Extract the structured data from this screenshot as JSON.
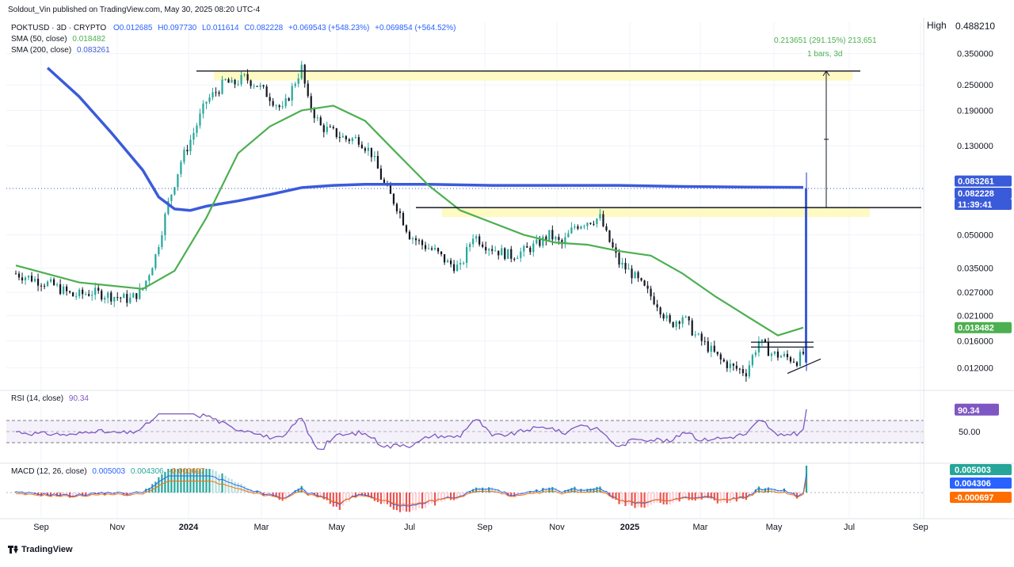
{
  "header": {
    "published": "Soldout_Vin published on TradingView.com, May 30, 2025 08:20 UTC-4"
  },
  "legend": {
    "symbol": "POKTUSD · 3D · CRYPTO",
    "open": "O0.012685",
    "high": "H0.097730",
    "low": "L0.011614",
    "close": "C0.082228",
    "change": "+0.069543 (+548.23%)",
    "change2": "+0.069854 (+564.52%)",
    "sma50_label": "SMA (50, close)",
    "sma50_value": "0.018482",
    "sma200_label": "SMA (200, close)",
    "sma200_value": "0.083261"
  },
  "measure": {
    "line1": "0.213651 (291.15%) 213,651",
    "line2": "1 bars, 3d"
  },
  "price_axis": {
    "high_label": "High",
    "high_value": "0.488210",
    "ticks": [
      "0.350000",
      "0.250000",
      "0.190000",
      "0.130000",
      "0.050000",
      "0.035000",
      "0.027000",
      "0.021000",
      "0.016000",
      "0.012000"
    ],
    "badge_sma200": "0.083261",
    "badge_price": "0.082228",
    "badge_time": "11:39:41",
    "badge_sma50": "0.018482"
  },
  "rsi": {
    "label": "RSI (14, close)",
    "value": "90.34",
    "badge": "90.34",
    "tick_50": "50.00"
  },
  "macd": {
    "label": "MACD (12, 26, close)",
    "v1": "0.005003",
    "v2": "0.004306",
    "v3": "-0.000697",
    "badge1": "0.005003",
    "badge2": "0.004306",
    "badge3": "-0.000697"
  },
  "time_axis": [
    "Sep",
    "Nov",
    "2024",
    "Mar",
    "May",
    "Jul",
    "Sep",
    "Nov",
    "2025",
    "Mar",
    "May",
    "Jul",
    "Sep"
  ],
  "footer": {
    "brand": "TradingView"
  },
  "colors": {
    "up": "#26a69a",
    "down": "#131722",
    "sma50": "#4caf50",
    "sma200": "#3a5bd9",
    "rsi": "#7e57c2",
    "macd_line": "#2962ff",
    "signal_line": "#ff6d00",
    "hist_up_strong": "#26a69a",
    "hist_up_weak": "#b2dfdb",
    "hist_down_strong": "#ef5350",
    "hist_down_weak": "#ffcdd2",
    "zone": "#fff9c4"
  },
  "chart_data": {
    "type": "candlestick",
    "symbol": "POKTUSD",
    "interval": "3D",
    "y_scale": "log",
    "ylim": [
      0.0095,
      0.49
    ],
    "x_labels": [
      "Sep",
      "Nov",
      "2024",
      "Mar",
      "May",
      "Jul",
      "Sep",
      "Nov",
      "2025",
      "Mar",
      "May",
      "Jul",
      "Sep"
    ],
    "close_path": [
      [
        0,
        0.033
      ],
      [
        6,
        0.031
      ],
      [
        12,
        0.029
      ],
      [
        18,
        0.026
      ],
      [
        24,
        0.027
      ],
      [
        30,
        0.026
      ],
      [
        36,
        0.025
      ],
      [
        40,
        0.028
      ],
      [
        44,
        0.04
      ],
      [
        48,
        0.07
      ],
      [
        52,
        0.11
      ],
      [
        56,
        0.15
      ],
      [
        60,
        0.21
      ],
      [
        64,
        0.24
      ],
      [
        66,
        0.26
      ],
      [
        68,
        0.25
      ],
      [
        72,
        0.27
      ],
      [
        76,
        0.25
      ],
      [
        80,
        0.22
      ],
      [
        84,
        0.19
      ],
      [
        88,
        0.26
      ],
      [
        90,
        0.3
      ],
      [
        92,
        0.21
      ],
      [
        96,
        0.16
      ],
      [
        100,
        0.15
      ],
      [
        104,
        0.14
      ],
      [
        108,
        0.14
      ],
      [
        112,
        0.12
      ],
      [
        116,
        0.085
      ],
      [
        120,
        0.068
      ],
      [
        124,
        0.05
      ],
      [
        128,
        0.045
      ],
      [
        132,
        0.042
      ],
      [
        136,
        0.037
      ],
      [
        140,
        0.035
      ],
      [
        144,
        0.05
      ],
      [
        148,
        0.045
      ],
      [
        152,
        0.042
      ],
      [
        156,
        0.04
      ],
      [
        160,
        0.042
      ],
      [
        164,
        0.045
      ],
      [
        168,
        0.05
      ],
      [
        172,
        0.045
      ],
      [
        176,
        0.055
      ],
      [
        180,
        0.058
      ],
      [
        184,
        0.06
      ],
      [
        186,
        0.05
      ],
      [
        190,
        0.037
      ],
      [
        194,
        0.033
      ],
      [
        198,
        0.028
      ],
      [
        202,
        0.024
      ],
      [
        206,
        0.019
      ],
      [
        210,
        0.021
      ],
      [
        214,
        0.017
      ],
      [
        218,
        0.015
      ],
      [
        222,
        0.013
      ],
      [
        226,
        0.012
      ],
      [
        230,
        0.0115
      ],
      [
        234,
        0.016
      ],
      [
        238,
        0.014
      ],
      [
        242,
        0.0135
      ],
      [
        246,
        0.013
      ],
      [
        248,
        0.014
      ],
      [
        249,
        0.082228
      ]
    ],
    "sma50": [
      [
        0,
        0.036
      ],
      [
        20,
        0.03
      ],
      [
        40,
        0.028
      ],
      [
        50,
        0.034
      ],
      [
        60,
        0.06
      ],
      [
        70,
        0.12
      ],
      [
        80,
        0.16
      ],
      [
        90,
        0.19
      ],
      [
        100,
        0.2
      ],
      [
        110,
        0.17
      ],
      [
        120,
        0.12
      ],
      [
        130,
        0.085
      ],
      [
        140,
        0.065
      ],
      [
        150,
        0.057
      ],
      [
        160,
        0.05
      ],
      [
        170,
        0.046
      ],
      [
        180,
        0.045
      ],
      [
        190,
        0.042
      ],
      [
        200,
        0.04
      ],
      [
        210,
        0.033
      ],
      [
        220,
        0.026
      ],
      [
        230,
        0.021
      ],
      [
        240,
        0.017
      ],
      [
        248,
        0.018482
      ]
    ],
    "sma200": [
      [
        10,
        0.3
      ],
      [
        20,
        0.22
      ],
      [
        30,
        0.15
      ],
      [
        40,
        0.1
      ],
      [
        45,
        0.075
      ],
      [
        50,
        0.066
      ],
      [
        55,
        0.065
      ],
      [
        60,
        0.068
      ],
      [
        70,
        0.072
      ],
      [
        80,
        0.077
      ],
      [
        90,
        0.083
      ],
      [
        100,
        0.085
      ],
      [
        110,
        0.086
      ],
      [
        130,
        0.086
      ],
      [
        150,
        0.085
      ],
      [
        170,
        0.085
      ],
      [
        190,
        0.085
      ],
      [
        210,
        0.084
      ],
      [
        230,
        0.0835
      ],
      [
        248,
        0.083261
      ]
    ],
    "levels": [
      {
        "name": "resistance",
        "value": 0.29
      },
      {
        "name": "support",
        "value": 0.067
      },
      {
        "name": "range-top",
        "value": 0.0158
      },
      {
        "name": "range-mid",
        "value": 0.015
      }
    ],
    "current_price": 0.082228,
    "rsi_value": 90.34,
    "rsi_levels": [
      70,
      50,
      30
    ],
    "macd": {
      "macd": 0.005003,
      "signal": 0.004306,
      "histogram": -0.000697
    }
  }
}
